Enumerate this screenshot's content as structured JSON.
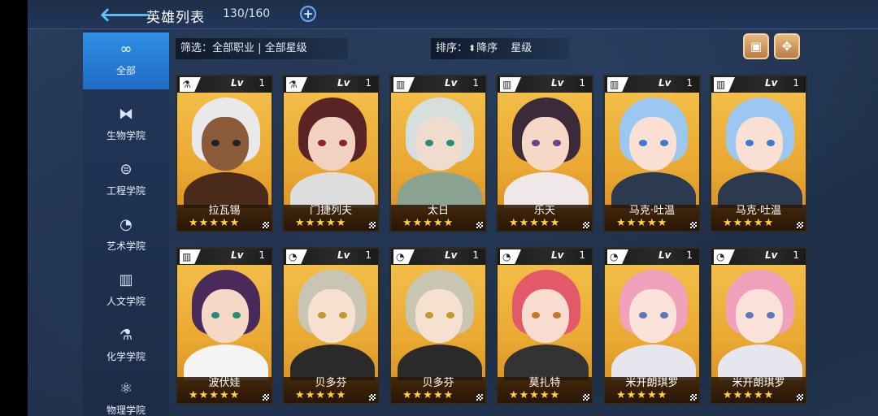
{
  "header": {
    "title": "英雄列表",
    "count": "130/160",
    "back_icon": "back-arrow-icon",
    "add_icon": "plus-icon"
  },
  "sidebar": {
    "items": [
      {
        "label": "全部",
        "icon": "all-icon",
        "active": true
      },
      {
        "label": "生物学院",
        "icon": "dna-icon"
      },
      {
        "label": "工程学院",
        "icon": "robot-icon"
      },
      {
        "label": "艺术学院",
        "icon": "palette-icon"
      },
      {
        "label": "人文学院",
        "icon": "book-icon"
      },
      {
        "label": "化学学院",
        "icon": "flask-icon"
      },
      {
        "label": "物理学院",
        "icon": "atom-icon"
      }
    ]
  },
  "filter": {
    "label": "筛选：全部职业 | 全部星级"
  },
  "sort": {
    "label": "排序：",
    "order": "降序",
    "field": "星级"
  },
  "colors": {
    "accent": "#2f8fe6",
    "card_gold": "#f4c34d",
    "star": "#ffd24a"
  },
  "cards": [
    {
      "name": "拉瓦锡",
      "lv_label": "Lv",
      "level": "1",
      "stars": "★★★★★",
      "class_icon": "flask-icon"
    },
    {
      "name": "门捷列夫",
      "lv_label": "Lv",
      "level": "1",
      "stars": "★★★★★",
      "class_icon": "flask-icon"
    },
    {
      "name": "太日",
      "lv_label": "Lv",
      "level": "1",
      "stars": "★★★★★",
      "class_icon": "book-icon"
    },
    {
      "name": "乐天",
      "lv_label": "Lv",
      "level": "1",
      "stars": "★★★★★",
      "class_icon": "book-icon"
    },
    {
      "name": "马克·吐温",
      "lv_label": "Lv",
      "level": "1",
      "stars": "★★★★★",
      "class_icon": "book-icon"
    },
    {
      "name": "马克·吐温",
      "lv_label": "Lv",
      "level": "1",
      "stars": "★★★★★",
      "class_icon": "book-icon"
    },
    {
      "name": "波伏娃",
      "lv_label": "Lv",
      "level": "1",
      "stars": "★★★★★",
      "class_icon": "book-icon"
    },
    {
      "name": "贝多芬",
      "lv_label": "Lv",
      "level": "1",
      "stars": "★★★★★",
      "class_icon": "palette-icon"
    },
    {
      "name": "贝多芬",
      "lv_label": "Lv",
      "level": "1",
      "stars": "★★★★★",
      "class_icon": "palette-icon"
    },
    {
      "name": "莫扎特",
      "lv_label": "Lv",
      "level": "1",
      "stars": "★★★★★",
      "class_icon": "palette-icon"
    },
    {
      "name": "米开朗琪罗",
      "lv_label": "Lv",
      "level": "1",
      "stars": "★★★★★",
      "class_icon": "palette-icon"
    },
    {
      "name": "米开朗琪罗",
      "lv_label": "Lv",
      "level": "1",
      "stars": "★★★★★",
      "class_icon": "palette-icon"
    }
  ]
}
